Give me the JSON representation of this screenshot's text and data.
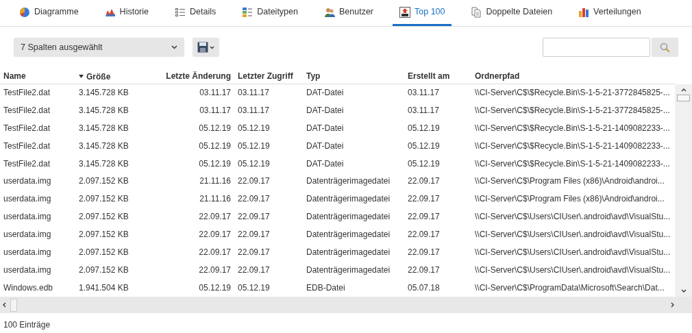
{
  "tabs": [
    {
      "label": "Diagramme",
      "selected": false
    },
    {
      "label": "Historie",
      "selected": false
    },
    {
      "label": "Details",
      "selected": false
    },
    {
      "label": "Dateitypen",
      "selected": false
    },
    {
      "label": "Benutzer",
      "selected": false
    },
    {
      "label": "Top 100",
      "selected": true
    },
    {
      "label": "Doppelte Dateien",
      "selected": false
    },
    {
      "label": "Verteilungen",
      "selected": false
    }
  ],
  "column_select": {
    "value": "7 Spalten ausgewählt"
  },
  "table": {
    "columns": [
      {
        "label": "Name",
        "sorted": false
      },
      {
        "label": "Größe",
        "sorted": true
      },
      {
        "label": "Letzte Änderung",
        "sorted": false
      },
      {
        "label": "Letzter Zugriff",
        "sorted": false
      },
      {
        "label": "Typ",
        "sorted": false
      },
      {
        "label": "Erstellt am",
        "sorted": false
      },
      {
        "label": "Ordnerpfad",
        "sorted": false
      }
    ],
    "rows": [
      [
        "TestFile2.dat",
        "3.145.728 KB",
        "03.11.17",
        "03.11.17",
        "DAT-Datei",
        "03.11.17",
        "\\\\CI-Server\\C$\\$Recycle.Bin\\S-1-5-21-3772845825-..."
      ],
      [
        "TestFile2.dat",
        "3.145.728 KB",
        "03.11.17",
        "03.11.17",
        "DAT-Datei",
        "03.11.17",
        "\\\\CI-Server\\C$\\$Recycle.Bin\\S-1-5-21-3772845825-..."
      ],
      [
        "TestFile2.dat",
        "3.145.728 KB",
        "05.12.19",
        "05.12.19",
        "DAT-Datei",
        "05.12.19",
        "\\\\CI-Server\\C$\\$Recycle.Bin\\S-1-5-21-1409082233-..."
      ],
      [
        "TestFile2.dat",
        "3.145.728 KB",
        "05.12.19",
        "05.12.19",
        "DAT-Datei",
        "05.12.19",
        "\\\\CI-Server\\C$\\$Recycle.Bin\\S-1-5-21-1409082233-..."
      ],
      [
        "TestFile2.dat",
        "3.145.728 KB",
        "05.12.19",
        "05.12.19",
        "DAT-Datei",
        "05.12.19",
        "\\\\CI-Server\\C$\\$Recycle.Bin\\S-1-5-21-1409082233-..."
      ],
      [
        "userdata.img",
        "2.097.152 KB",
        "21.11.16",
        "22.09.17",
        "Datenträgerimagedatei",
        "22.09.17",
        "\\\\CI-Server\\C$\\Program Files (x86)\\Android\\androi..."
      ],
      [
        "userdata.img",
        "2.097.152 KB",
        "21.11.16",
        "22.09.17",
        "Datenträgerimagedatei",
        "22.09.17",
        "\\\\CI-Server\\C$\\Program Files (x86)\\Android\\androi..."
      ],
      [
        "userdata.img",
        "2.097.152 KB",
        "22.09.17",
        "22.09.17",
        "Datenträgerimagedatei",
        "22.09.17",
        "\\\\CI-Server\\C$\\Users\\CIUser\\.android\\avd\\VisualStu..."
      ],
      [
        "userdata.img",
        "2.097.152 KB",
        "22.09.17",
        "22.09.17",
        "Datenträgerimagedatei",
        "22.09.17",
        "\\\\CI-Server\\C$\\Users\\CIUser\\.android\\avd\\VisualStu..."
      ],
      [
        "userdata.img",
        "2.097.152 KB",
        "22.09.17",
        "22.09.17",
        "Datenträgerimagedatei",
        "22.09.17",
        "\\\\CI-Server\\C$\\Users\\CIUser\\.android\\avd\\VisualStu..."
      ],
      [
        "userdata.img",
        "2.097.152 KB",
        "22.09.17",
        "22.09.17",
        "Datenträgerimagedatei",
        "22.09.17",
        "\\\\CI-Server\\C$\\Users\\CIUser\\.android\\avd\\VisualStu..."
      ],
      [
        "Windows.edb",
        "1.941.504 KB",
        "05.12.19",
        "05.12.19",
        "EDB-Datei",
        "05.07.18",
        "\\\\CI-Server\\C$\\ProgramData\\Microsoft\\Search\\Dat..."
      ]
    ]
  },
  "status_bar": {
    "text": "100 Einträge"
  }
}
